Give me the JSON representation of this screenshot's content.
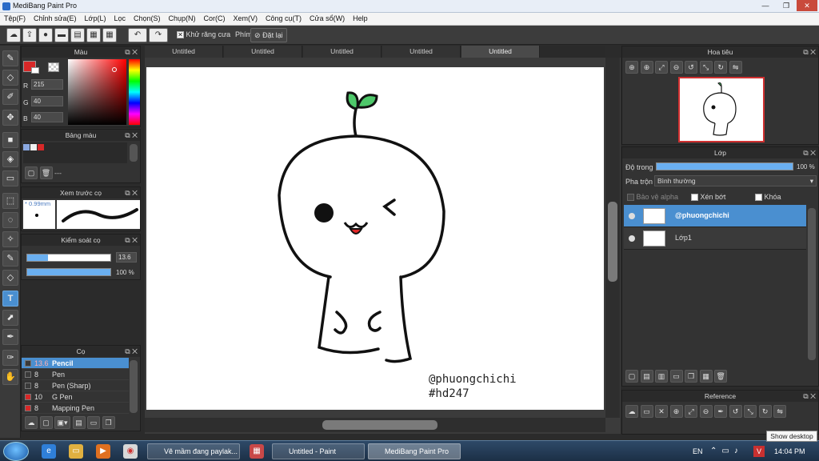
{
  "window": {
    "title": "MediBang Paint Pro",
    "controls": [
      "—",
      "❐",
      "✕"
    ]
  },
  "menu": [
    "Tệp(F)",
    "Chỉnh sửa(E)",
    "Lớp(L)",
    "Lọc",
    "Chọn(S)",
    "Chụp(N)",
    "Cor(C)",
    "Xem(V)",
    "Công cụ(T)",
    "Cửa sổ(W)",
    "Help"
  ],
  "toolbar": {
    "antialias_label": "Khử răng cưa",
    "antialias_checked": "✕",
    "phim_label": "Phím",
    "reset_label": "Đặt lại"
  },
  "color_panel": {
    "title": "Màu",
    "r_label": "R",
    "r": "215",
    "g_label": "G",
    "g": "40",
    "b_label": "B",
    "b": "40",
    "fg_color": "#d72828",
    "bg_color": "#ffffff"
  },
  "palette_panel": {
    "title": "Bảng màu",
    "swatches": [
      "#8aa8e0",
      "#f0f0f0",
      "#d72828"
    ],
    "empty_label": "---"
  },
  "brush_preview": {
    "title": "Xem trước cọ",
    "size": "0.99mm"
  },
  "brush_control": {
    "title": "Kiểm soát cọ",
    "size_value": "13.6",
    "size_fraction": 0.25,
    "opacity_value": "100 %",
    "opacity_fraction": 1.0
  },
  "brush_panel": {
    "title": "Cọ",
    "items": [
      {
        "size": "13.6",
        "name": "Pencil",
        "color": "#3a3a3a"
      },
      {
        "size": "8",
        "name": "Pen",
        "color": "#3a3a3a"
      },
      {
        "size": "8",
        "name": "Pen (Sharp)",
        "color": "#3a3a3a"
      },
      {
        "size": "10",
        "name": "G Pen",
        "color": "#d72828"
      },
      {
        "size": "8",
        "name": "Mapping Pen",
        "color": "#d72828"
      }
    ]
  },
  "tabs": [
    "Untitled",
    "Untitled",
    "Untitled",
    "Untitled",
    "Untitled"
  ],
  "canvas": {
    "watermark_line1": "@phuongchichi",
    "watermark_line2": "#hd247"
  },
  "navigator": {
    "title": "Hoa tiêu"
  },
  "layers": {
    "title": "Lớp",
    "opacity_label": "Độ trong",
    "opacity_value": "100 %",
    "blend_label": "Pha trộn",
    "blend_value": "Bình thường",
    "protect_alpha": "Bảo vệ alpha",
    "clip": "Xén bớt",
    "lock": "Khóa",
    "items": [
      {
        "name": "@phuongchichi",
        "selected": true
      },
      {
        "name": "Lớp1",
        "selected": false
      }
    ]
  },
  "reference": {
    "title": "Reference"
  },
  "taskbar": {
    "items": [
      "Vẽ mầm đang paylak...",
      "Untitled - Paint",
      "MediBang Paint Pro"
    ],
    "lang": "EN",
    "time": "14:04 PM",
    "tooltip": "Show desktop"
  }
}
